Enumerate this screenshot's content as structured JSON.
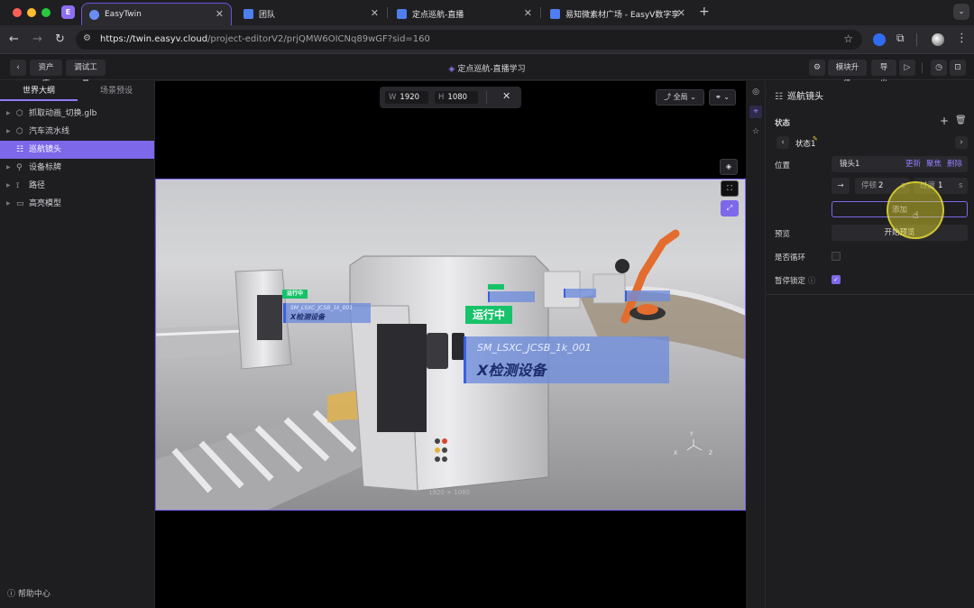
{
  "browser": {
    "tabs": [
      {
        "title": "EasyTwin",
        "active": true
      },
      {
        "title": "团队"
      },
      {
        "title": "定点巡航-直播"
      },
      {
        "title": "易知微素材广场 - EasyV数字孪"
      }
    ],
    "url_host": "https://twin.easyv.cloud",
    "url_path": "/project-editorV2/prjQMW6OICNq89wGF?sid=160",
    "ext_letter": "E"
  },
  "header": {
    "back_label": "<",
    "asset_lib": "资产库",
    "debug_tools": "调试工具",
    "project_title": "定点巡航-直播学习",
    "upgrade": "模块升级",
    "export": "导出"
  },
  "left_panel": {
    "tabs": [
      "世界大纲",
      "场景预设"
    ],
    "items": [
      {
        "label": "抓取动画_切换.glb",
        "icon": "cube-icon"
      },
      {
        "label": "汽车流水线",
        "icon": "cube-icon"
      },
      {
        "label": "巡航镜头",
        "icon": "camera-path-icon",
        "selected": true
      },
      {
        "label": "设备标牌",
        "icon": "tag-icon"
      },
      {
        "label": "路径",
        "icon": "path-icon"
      },
      {
        "label": "高亮模型",
        "icon": "folder-icon"
      }
    ],
    "help": "帮助中心"
  },
  "viewport": {
    "w_label": "W",
    "w_value": "1920",
    "h_label": "H",
    "h_value": "1080",
    "view_mode": "全局",
    "scene": {
      "big_tag": "运行中",
      "big_code": "SM_LSXC_JCSB_1k_001",
      "big_name": "X检测设备",
      "small_tag": "运行中",
      "small_code": "SM_LSXC_JCSB_1k_001",
      "small_name": "X检测设备",
      "watermark": "1920 × 1080",
      "axis_x": "X",
      "axis_y": "Y",
      "axis_z": "Z"
    }
  },
  "right_panel": {
    "title": "巡航镜头",
    "state_label": "状态",
    "state_name": "状态1",
    "position_label": "位置",
    "camera_name": "镜头1",
    "update": "更新",
    "focus": "聚焦",
    "delete": "删除",
    "pause_label": "停顿",
    "pause_value": "2",
    "pause_unit": "s",
    "transition_label": "过渡",
    "transition_value": "1",
    "transition_unit": "s",
    "add_button": "添加",
    "preview_label": "预览",
    "start_preview": "开始预览",
    "loop_label": "是否循环",
    "loop_checked": false,
    "pause_lock_label": "暂停锁定",
    "pause_lock_checked": true
  }
}
